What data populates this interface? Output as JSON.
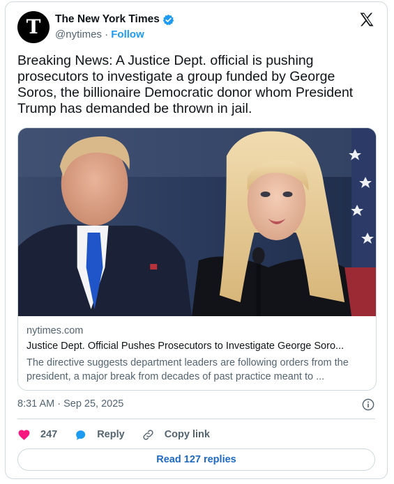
{
  "author": {
    "name": "The New York Times",
    "handle": "@nytimes",
    "separator": "·",
    "follow_label": "Follow",
    "verified": true,
    "avatar_glyph": "T",
    "verified_color": "#1d9bf0"
  },
  "tweet": {
    "text": "Breaking News: A Justice Dept. official is pushing prosecutors to investigate a group funded by George Soros, the billionaire Democratic donor whom President Trump has demanded be thrown in jail."
  },
  "link_card": {
    "domain": "nytimes.com",
    "title": "Justice Dept. Official Pushes Prosecutors to Investigate George Soro...",
    "description": "The directive suggests department leaders are following orders from the president, a major break from decades of past practice meant to ..."
  },
  "timestamp": "8:31 AM · Sep 25, 2025",
  "actions": {
    "like_count": "247",
    "reply_label": "Reply",
    "copy_link_label": "Copy link"
  },
  "read_replies_label": "Read 127 replies",
  "icons": [
    "x-logo-icon",
    "verified-badge-icon",
    "info-icon",
    "heart-icon",
    "reply-bubble-icon",
    "link-icon"
  ],
  "colors": {
    "accent": "#1d9bf0",
    "heart": "#f91880",
    "reply_icon": "#1d9bf0",
    "link_text": "#1d69c4"
  }
}
